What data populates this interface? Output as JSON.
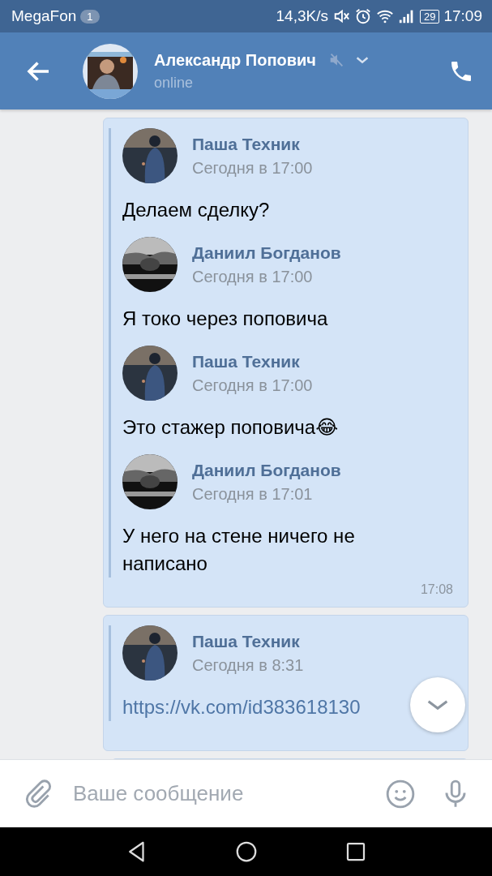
{
  "status_bar": {
    "carrier": "MegaFon",
    "notification_count": "1",
    "speed": "14,3K/s",
    "battery": "29",
    "time": "17:09"
  },
  "header": {
    "name": "Александр Попович",
    "status": "online",
    "muted": true
  },
  "messages": [
    {
      "time": "17:08",
      "forwarded": [
        {
          "name": "Паша Техник",
          "date": "Сегодня в 17:00",
          "text": "Делаем сделку?",
          "kind": "text"
        },
        {
          "name": "Даниил Богданов",
          "date": "Сегодня в 17:00",
          "text": "Я токо через поповича",
          "kind": "text"
        },
        {
          "name": "Паша Техник",
          "date": "Сегодня в 17:00",
          "text": "Это стажер поповича😂",
          "kind": "text"
        },
        {
          "name": "Даниил Богданов",
          "date": "Сегодня в 17:01",
          "text": "У него на стене ничего не написано",
          "kind": "text"
        }
      ]
    },
    {
      "forwarded": [
        {
          "name": "Паша Техник",
          "date": "Сегодня в 8:31",
          "text": "https://vk.com/id383618130",
          "kind": "link"
        }
      ]
    }
  ],
  "composer": {
    "placeholder": "Ваше сообщение"
  }
}
